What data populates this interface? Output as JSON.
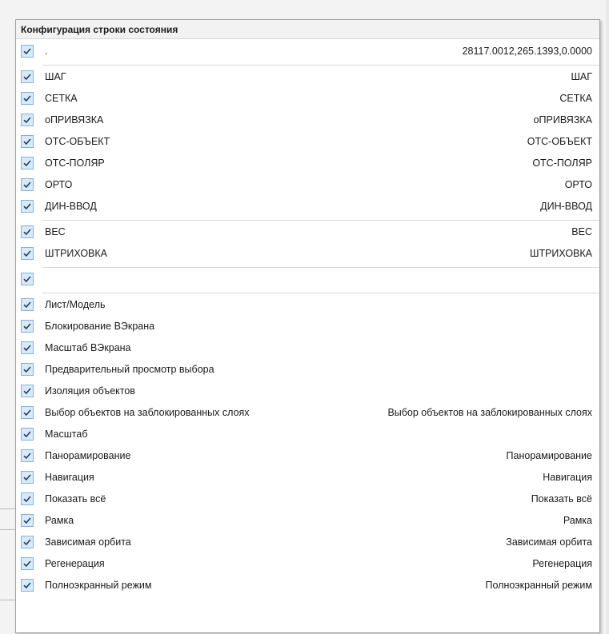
{
  "menu": {
    "header": "Конфигурация строки состояния",
    "groups": [
      [
        {
          "label": ".",
          "value": "28117.0012,265.1393,0.0000",
          "checked": true
        }
      ],
      [
        {
          "label": "ШАГ",
          "value": "ШАГ",
          "checked": true
        },
        {
          "label": "СЕТКА",
          "value": "СЕТКА",
          "checked": true
        },
        {
          "label": "оПРИВЯЗКА",
          "value": "оПРИВЯЗКА",
          "checked": true
        },
        {
          "label": "ОТС-ОБЪЕКТ",
          "value": "ОТС-ОБЪЕКТ",
          "checked": true
        },
        {
          "label": "ОТС-ПОЛЯР",
          "value": "ОТС-ПОЛЯР",
          "checked": true
        },
        {
          "label": "ОРТО",
          "value": "ОРТО",
          "checked": true
        },
        {
          "label": "ДИН-ВВОД",
          "value": "ДИН-ВВОД",
          "checked": true
        }
      ],
      [
        {
          "label": "ВЕС",
          "value": "ВЕС",
          "checked": true
        },
        {
          "label": "ШТРИХОВКА",
          "value": "ШТРИХОВКА",
          "checked": true
        }
      ],
      [
        {
          "label": "",
          "value": "",
          "checked": true
        }
      ],
      [
        {
          "label": "Лист/Модель",
          "value": "",
          "checked": true
        },
        {
          "label": "Блокирование ВЭкрана",
          "value": "",
          "checked": true
        },
        {
          "label": "Масштаб ВЭкрана",
          "value": "",
          "checked": true
        },
        {
          "label": "Предварительный просмотр выбора",
          "value": "",
          "checked": true
        },
        {
          "label": "Изоляция объектов",
          "value": "",
          "checked": true
        },
        {
          "label": "Выбор объектов на заблокированных слоях",
          "value": "Выбор объектов на заблокированных слоях",
          "checked": true
        },
        {
          "label": "Масштаб",
          "value": "",
          "checked": true
        },
        {
          "label": "Панорамирование",
          "value": "Панорамирование",
          "checked": true
        },
        {
          "label": "Навигация",
          "value": "Навигация",
          "checked": true
        },
        {
          "label": "Показать всё",
          "value": "Показать всё",
          "checked": true
        },
        {
          "label": "Рамка",
          "value": "Рамка",
          "checked": true
        },
        {
          "label": "Зависимая орбита",
          "value": "Зависимая орбита",
          "checked": true
        },
        {
          "label": "Регенерация",
          "value": "Регенерация",
          "checked": true
        },
        {
          "label": "Полноэкранный режим",
          "value": "Полноэкранный режим",
          "checked": true
        }
      ]
    ]
  },
  "colors": {
    "check_bg": "#d8eaf9",
    "check_border": "#7fb4de",
    "check_mark": "#1c3f6e",
    "separator": "#d9d9d9"
  }
}
